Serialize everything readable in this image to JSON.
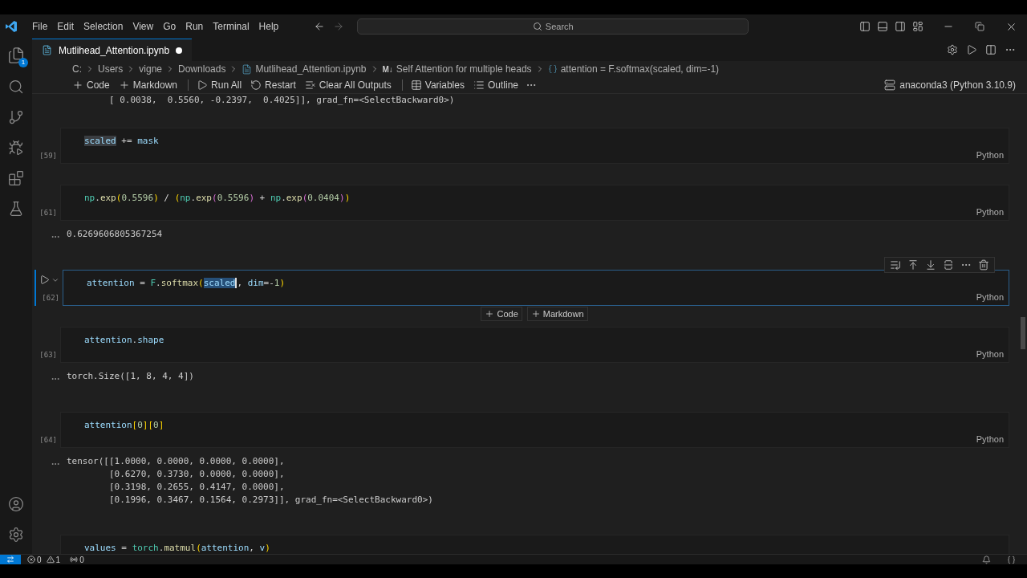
{
  "title_bar": {
    "menu": [
      "File",
      "Edit",
      "Selection",
      "View",
      "Go",
      "Run",
      "Terminal",
      "Help"
    ],
    "search": {
      "placeholder": "Search"
    }
  },
  "activity_bar": {
    "explorer_badge": "1"
  },
  "tab": {
    "label": "Mutlihead_Attention.ipynb",
    "modified": true,
    "selected": true
  },
  "breadcrumb": [
    {
      "kind": "text",
      "label": "C:"
    },
    {
      "kind": "text",
      "label": "Users"
    },
    {
      "kind": "text",
      "label": "vigne"
    },
    {
      "kind": "text",
      "label": "Downloads"
    },
    {
      "kind": "file",
      "label": "Mutlihead_Attention.ipynb"
    },
    {
      "kind": "markdown",
      "icon_text": "M↓",
      "label": "Self Attention for multiple heads"
    },
    {
      "kind": "code",
      "label": "attention = F.softmax(scaled, dim=-1)"
    }
  ],
  "toolbar": [
    {
      "kind": "add",
      "label": "Code"
    },
    {
      "kind": "add",
      "label": "Markdown"
    },
    {
      "kind": "separator"
    },
    {
      "kind": "run",
      "label": "Run All"
    },
    {
      "kind": "restart",
      "label": "Restart"
    },
    {
      "kind": "clear",
      "label": "Clear All Outputs"
    },
    {
      "kind": "separator"
    },
    {
      "kind": "variables",
      "label": "Variables"
    },
    {
      "kind": "outline",
      "label": "Outline"
    },
    {
      "kind": "more"
    }
  ],
  "kernel": "anaconda3 (Python 3.10.9)",
  "cells": [
    {
      "kind": "output",
      "lines": [
        "        [ 0.0038,  0.5560, -0.2397,  0.4025]], grad_fn=<SelectBackward0>)"
      ]
    },
    {
      "kind": "code",
      "selected": false,
      "execution_count": "[59]",
      "language": "Python",
      "lines": [
        [
          {
            "text": "scaled",
            "kind": "match"
          },
          {
            "text": " += ",
            "kind": "op"
          },
          {
            "text": "mask",
            "kind": "var"
          }
        ]
      ]
    },
    {
      "kind": "code",
      "selected": false,
      "execution_count": "[61]",
      "language": "Python",
      "lines": [
        [
          {
            "text": "np",
            "kind": "mod"
          },
          {
            "text": ".",
            "kind": "op"
          },
          {
            "text": "exp",
            "kind": "fn"
          },
          {
            "text": "(",
            "kind": "p1"
          },
          {
            "text": "0.5596",
            "kind": "num"
          },
          {
            "text": ")",
            "kind": "p1"
          },
          {
            "text": " / ",
            "kind": "op"
          },
          {
            "text": "(",
            "kind": "p1"
          },
          {
            "text": "np",
            "kind": "mod"
          },
          {
            "text": ".",
            "kind": "op"
          },
          {
            "text": "exp",
            "kind": "fn"
          },
          {
            "text": "(",
            "kind": "p2"
          },
          {
            "text": "0.5596",
            "kind": "num"
          },
          {
            "text": ")",
            "kind": "p2"
          },
          {
            "text": " + ",
            "kind": "op"
          },
          {
            "text": "np",
            "kind": "mod"
          },
          {
            "text": ".",
            "kind": "op"
          },
          {
            "text": "exp",
            "kind": "fn"
          },
          {
            "text": "(",
            "kind": "p2"
          },
          {
            "text": "0.0404",
            "kind": "num"
          },
          {
            "text": ")",
            "kind": "p2"
          },
          {
            "text": ")",
            "kind": "p1"
          }
        ]
      ],
      "output": [
        "0.6269606805367254"
      ]
    },
    {
      "kind": "code",
      "selected": true,
      "execution_count": "[62]",
      "language": "Python",
      "lines": [
        [
          {
            "text": "attention",
            "kind": "var"
          },
          {
            "text": " = ",
            "kind": "op"
          },
          {
            "text": "F",
            "kind": "mod"
          },
          {
            "text": ".",
            "kind": "op"
          },
          {
            "text": "softmax",
            "kind": "fn"
          },
          {
            "text": "(",
            "kind": "p1"
          },
          {
            "text": "scaled",
            "kind": "match_cursor"
          },
          {
            "text": ", ",
            "kind": "op"
          },
          {
            "text": "dim",
            "kind": "var"
          },
          {
            "text": "=-",
            "kind": "op"
          },
          {
            "text": "1",
            "kind": "num"
          },
          {
            "text": ")",
            "kind": "p1"
          }
        ]
      ],
      "insert_bar": [
        "Code",
        "Markdown"
      ]
    },
    {
      "kind": "code",
      "selected": false,
      "execution_count": "[63]",
      "language": "Python",
      "lines": [
        [
          {
            "text": "attention",
            "kind": "var"
          },
          {
            "text": ".",
            "kind": "op"
          },
          {
            "text": "shape",
            "kind": "var"
          }
        ]
      ],
      "output": [
        "torch.Size([1, 8, 4, 4])"
      ]
    },
    {
      "kind": "code",
      "selected": false,
      "execution_count": "[64]",
      "language": "Python",
      "lines": [
        [
          {
            "text": "attention",
            "kind": "var"
          },
          {
            "text": "[",
            "kind": "p1"
          },
          {
            "text": "0",
            "kind": "num"
          },
          {
            "text": "]",
            "kind": "p1"
          },
          {
            "text": "[",
            "kind": "p1"
          },
          {
            "text": "0",
            "kind": "num"
          },
          {
            "text": "]",
            "kind": "p1"
          }
        ]
      ],
      "output": [
        "tensor([[1.0000, 0.0000, 0.0000, 0.0000],",
        "        [0.6270, 0.3730, 0.0000, 0.0000],",
        "        [0.3198, 0.2655, 0.4147, 0.0000],",
        "        [0.1996, 0.3467, 0.1564, 0.2973]], grad_fn=<SelectBackward0>)"
      ]
    },
    {
      "kind": "code",
      "selected": false,
      "lines": [
        [
          {
            "text": "values",
            "kind": "var"
          },
          {
            "text": " = ",
            "kind": "op"
          },
          {
            "text": "torch",
            "kind": "mod"
          },
          {
            "text": ".",
            "kind": "op"
          },
          {
            "text": "matmul",
            "kind": "fn"
          },
          {
            "text": "(",
            "kind": "p1"
          },
          {
            "text": "attention",
            "kind": "var"
          },
          {
            "text": ", ",
            "kind": "op"
          },
          {
            "text": "v",
            "kind": "var"
          },
          {
            "text": ")",
            "kind": "p1"
          }
        ]
      ]
    }
  ],
  "status_bar": {
    "errors": "0",
    "warnings": "1",
    "ports": "0"
  }
}
